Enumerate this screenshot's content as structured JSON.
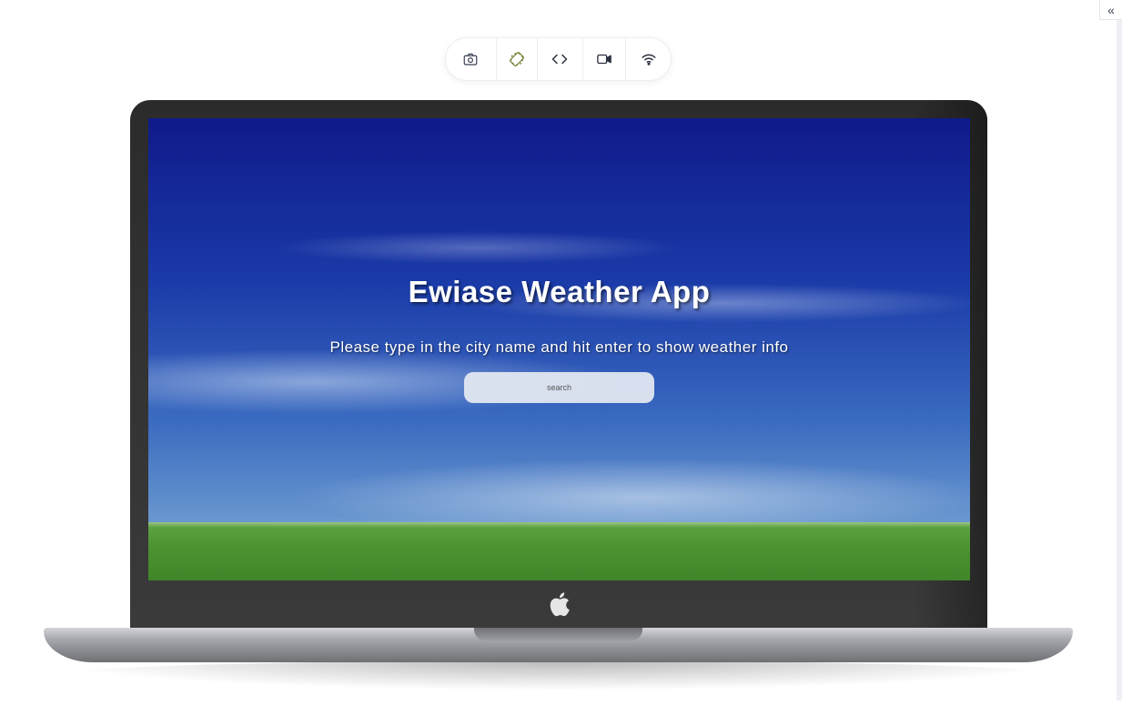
{
  "app": {
    "title": "Ewiase Weather App",
    "subtitle": "Please type in the city name and hit enter to show weather info",
    "search": {
      "placeholder": "search",
      "value": ""
    }
  },
  "toolbar": {
    "items": [
      {
        "name": "screenshot",
        "icon": "camera-icon"
      },
      {
        "name": "rotate",
        "icon": "rotate-icon"
      },
      {
        "name": "code",
        "icon": "code-icon"
      },
      {
        "name": "record",
        "icon": "video-icon"
      },
      {
        "name": "network",
        "icon": "wifi-icon"
      }
    ]
  },
  "sidebar": {
    "collapse_icon": "double-chevron-left-icon",
    "collapse_glyph": "«"
  },
  "device": {
    "type": "laptop",
    "logo_icon": "apple-logo-icon"
  },
  "colors": {
    "sky_top": "#101a8a",
    "sky_bottom": "#8fb3d8",
    "grass": "#4c9432",
    "bezel": "#333333"
  }
}
